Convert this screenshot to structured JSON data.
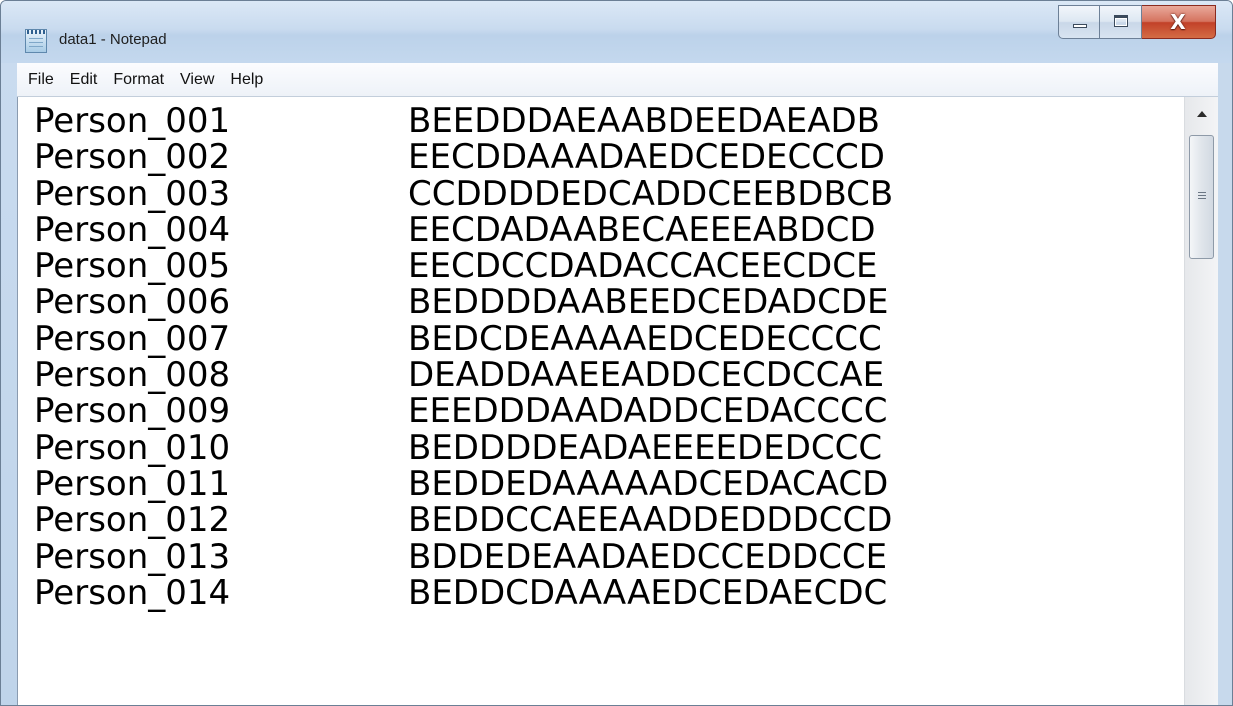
{
  "window": {
    "title": "data1 - Notepad",
    "app_icon": "notepad-icon",
    "caption": {
      "minimize_icon": "minimize-icon",
      "maximize_icon": "maximize-icon",
      "close_glyph": "X"
    }
  },
  "menu": {
    "items": [
      {
        "label": "File"
      },
      {
        "label": "Edit"
      },
      {
        "label": "Format"
      },
      {
        "label": "View"
      },
      {
        "label": "Help"
      }
    ]
  },
  "document": {
    "lines": [
      {
        "person": "Person_001",
        "code": "BEEDDDAEAABDEEDAEADB"
      },
      {
        "person": "Person_002",
        "code": "EECDDAAADAEDCEDECCCD"
      },
      {
        "person": "Person_003",
        "code": "CCDDDDEDCADDCEEBDBCB"
      },
      {
        "person": "Person_004",
        "code": "EECDADAABECAEEEABDCD"
      },
      {
        "person": "Person_005",
        "code": "EECDCCDADACCACEECDCE"
      },
      {
        "person": "Person_006",
        "code": "BEDDDDAABEEDCEDADCDE"
      },
      {
        "person": "Person_007",
        "code": "BEDCDEAAAAEDCEDECCCC"
      },
      {
        "person": "Person_008",
        "code": "DEADDAAEEADDCECDCCAE"
      },
      {
        "person": "Person_009",
        "code": "EEEDDDAADADDCEDACCCC"
      },
      {
        "person": "Person_010",
        "code": "BEDDDDEADAEEEEDEDCCC"
      },
      {
        "person": "Person_011",
        "code": "BEDDEDAAAAADCEDACACD"
      },
      {
        "person": "Person_012",
        "code": "BEDDCCAEEAADDEDDDCCD"
      },
      {
        "person": "Person_013",
        "code": "BDDEDEAADAEDCCEDDCCE"
      },
      {
        "person": "Person_014",
        "code": "BEDDCDAAAAEDCEDAECDC"
      }
    ]
  },
  "scrollbar": {
    "up_icon": "scroll-up-arrow-icon",
    "thumb_grip_icon": "grip-icon"
  }
}
